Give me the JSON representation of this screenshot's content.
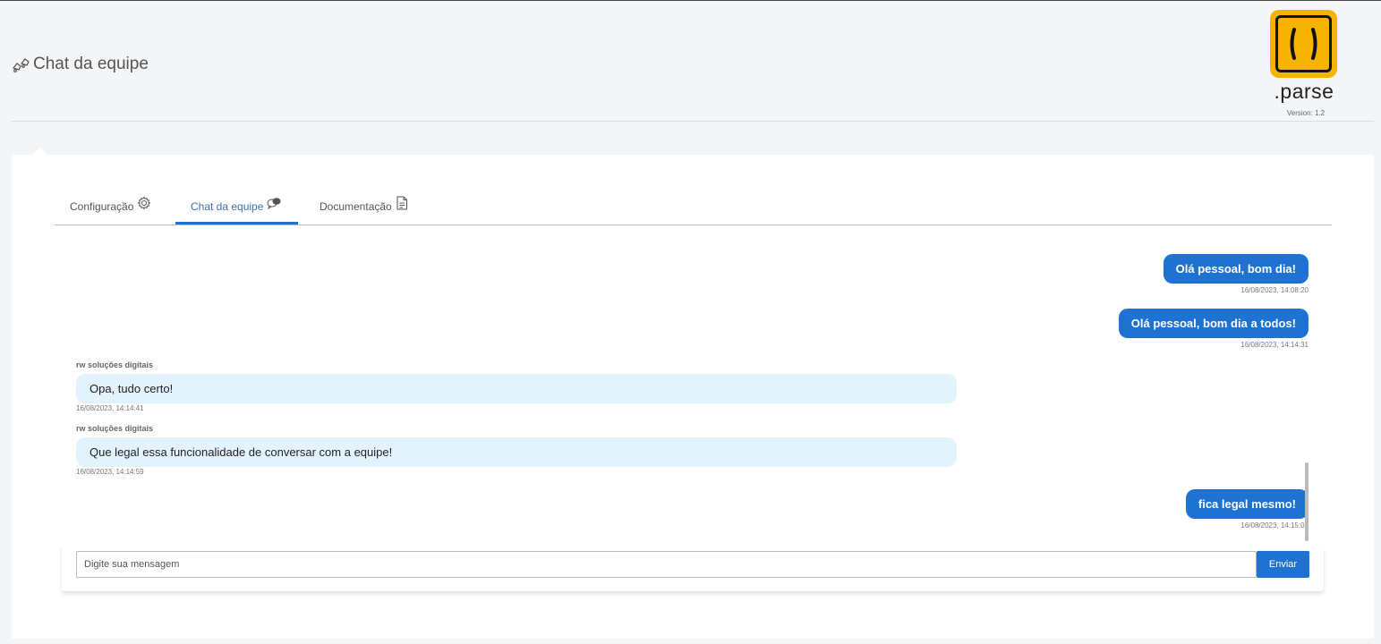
{
  "header": {
    "title": "Chat da equipe",
    "logo_text": ".parse",
    "version": "Version: 1.2"
  },
  "tabs": [
    {
      "label": "Configuração",
      "icon": "gear-icon",
      "active": false
    },
    {
      "label": "Chat da equipe",
      "icon": "chat-icon",
      "active": true
    },
    {
      "label": "Documentação",
      "icon": "document-icon",
      "active": false
    }
  ],
  "messages": [
    {
      "direction": "out",
      "text": "Olá pessoal, bom dia!",
      "timestamp": "16/08/2023, 14:08:20"
    },
    {
      "direction": "out",
      "text": "Olá pessoal, bom dia a todos!",
      "timestamp": "16/08/2023, 14:14:31"
    },
    {
      "direction": "in",
      "sender": "rw soluções digitais",
      "text": "Opa, tudo certo!",
      "timestamp": "16/08/2023, 14:14:41"
    },
    {
      "direction": "in",
      "sender": "rw soluções digitais",
      "text": "Que legal essa funcionalidade de conversar com a equipe!",
      "timestamp": "16/08/2023, 14:14:59"
    },
    {
      "direction": "out",
      "text": "fica legal mesmo!",
      "timestamp": "16/08/2023, 14:15:05"
    }
  ],
  "composer": {
    "placeholder": "Digite sua mensagem",
    "send_label": "Enviar"
  },
  "colors": {
    "accent": "#1f72d1",
    "incoming_bubble": "#e2f3fd",
    "logo_yellow": "#f5b400"
  }
}
